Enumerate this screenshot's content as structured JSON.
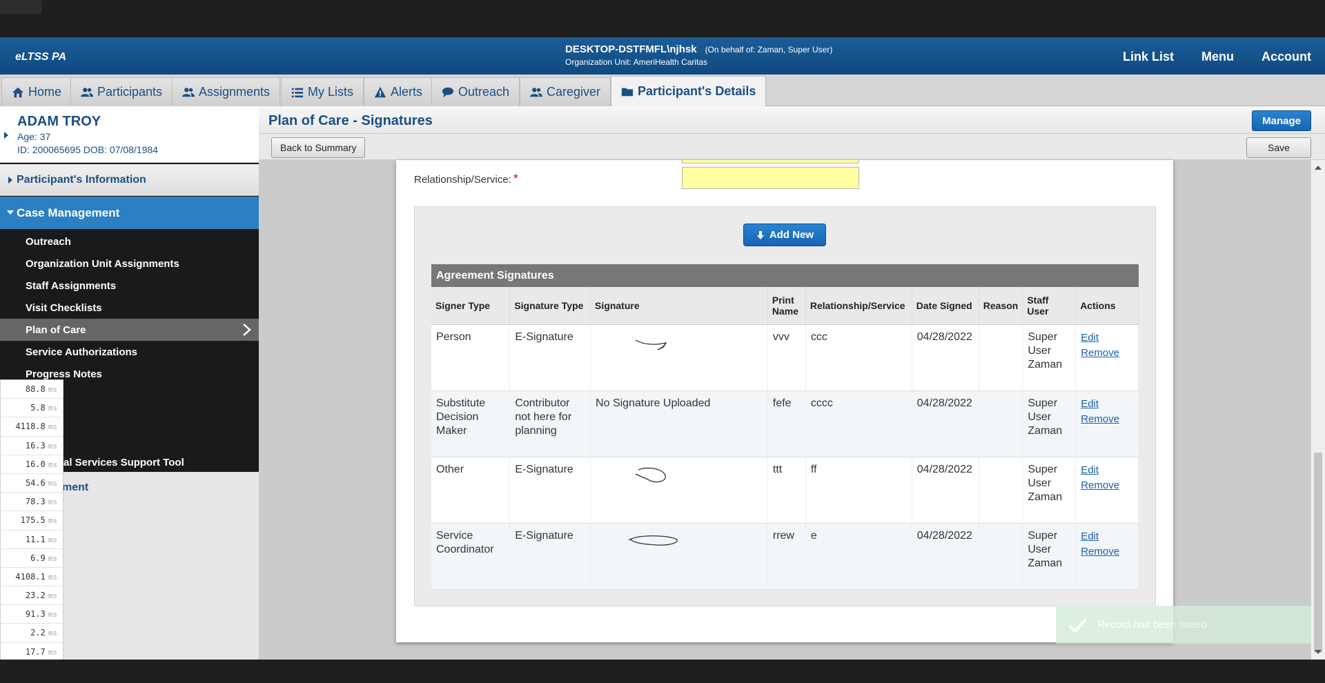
{
  "header": {
    "brand": "eLTSS PA",
    "user": "DESKTOP-DSTFMFL\\njhsk",
    "on_behalf": "(On behalf of: Zaman, Super User)",
    "org_unit": "Organization Unit: AmeriHealth Caritas",
    "links": [
      "Link List",
      "Menu",
      "Account"
    ]
  },
  "nav": {
    "tabs": [
      {
        "label": "Home",
        "icon": "home-icon"
      },
      {
        "label": "Participants",
        "icon": "people-icon"
      },
      {
        "label": "Assignments",
        "icon": "people-icon"
      },
      {
        "label": "My Lists",
        "icon": "list-icon"
      },
      {
        "label": "Alerts",
        "icon": "alert-icon"
      },
      {
        "label": "Outreach",
        "icon": "chat-icon"
      },
      {
        "label": "Caregiver",
        "icon": "people-icon"
      },
      {
        "label": "Participant's Details",
        "icon": "folder-icon"
      }
    ]
  },
  "participant": {
    "name": "ADAM TROY",
    "age": "Age: 37",
    "id_dob": "ID: 200065695 DOB: 07/08/1984"
  },
  "sidebar": {
    "section_info": "Participant's Information",
    "section_cm": "Case Management",
    "items": [
      "Outreach",
      "Organization Unit Assignments",
      "Staff Assignments",
      "Visit Checklists",
      "Plan of Care",
      "Service Authorizations",
      "Progress Notes",
      "al Services Support Tool"
    ],
    "section_bottom": "ment"
  },
  "timings": [
    "88.8",
    "5.8",
    "4118.8",
    "16.3",
    "16.0",
    "54.6",
    "78.3",
    "175.5",
    "11.1",
    "6.9",
    "4108.1",
    "23.2",
    "91.3",
    "2.2",
    "17.7"
  ],
  "timing_unit": "ms",
  "page": {
    "title": "Plan of Care - Signatures",
    "manage": "Manage",
    "back": "Back to Summary",
    "save": "Save"
  },
  "form": {
    "relationship_label": "Relationship/Service:",
    "required_mark": "*"
  },
  "signatures": {
    "add_new": "Add New",
    "table_title": "Agreement Signatures",
    "columns": [
      "Signer Type",
      "Signature Type",
      "Signature",
      "Print Name",
      "Relationship/Service",
      "Date Signed",
      "Reason",
      "Staff User",
      "Actions"
    ],
    "rows": [
      {
        "signer_type": "Person",
        "signature_type": "E-Signature",
        "signature": "",
        "print_name": "vvv",
        "relationship": "ccc",
        "date_signed": "04/28/2022",
        "reason": "",
        "staff_user": "Super User Zaman",
        "edit": "Edit",
        "remove": "Remove"
      },
      {
        "signer_type": "Substitute Decision Maker",
        "signature_type": "Contributor not here for planning",
        "signature": "No Signature Uploaded",
        "print_name": "fefe",
        "relationship": "cccc",
        "date_signed": "04/28/2022",
        "reason": "",
        "staff_user": "Super User Zaman",
        "edit": "Edit",
        "remove": "Remove"
      },
      {
        "signer_type": "Other",
        "signature_type": "E-Signature",
        "signature": "",
        "print_name": "ttt",
        "relationship": "ff",
        "date_signed": "04/28/2022",
        "reason": "",
        "staff_user": "Super User Zaman",
        "edit": "Edit",
        "remove": "Remove"
      },
      {
        "signer_type": "Service Coordinator",
        "signature_type": "E-Signature",
        "signature": "",
        "print_name": "rrew",
        "relationship": "e",
        "date_signed": "04/28/2022",
        "reason": "",
        "staff_user": "Super User Zaman",
        "edit": "Edit",
        "remove": "Remove"
      }
    ]
  },
  "toast": {
    "message": "Record has been saved",
    "icon": "check-icon"
  },
  "colors": {
    "header_blue": "#0f4a80",
    "link_blue": "#1b4f84",
    "accent_blue": "#2c7fc0",
    "required_red": "#d11",
    "field_yellow": "#ffffa0"
  }
}
